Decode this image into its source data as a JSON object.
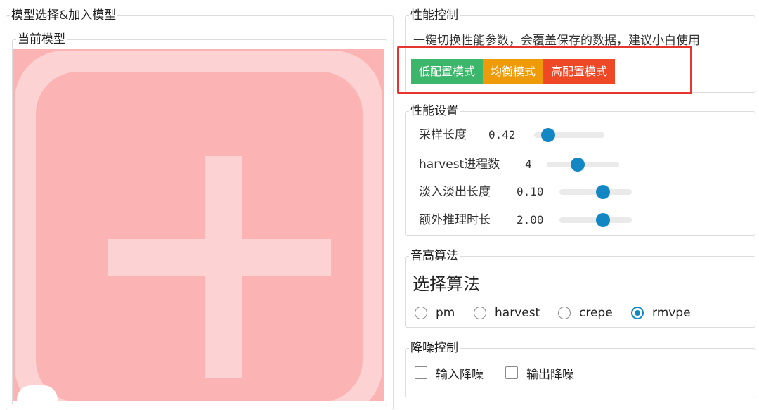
{
  "left": {
    "group_title": "模型选择&加入模型",
    "current_title": "当前模型",
    "add_tile_icon": "plus-icon"
  },
  "performance_control": {
    "title": "性能控制",
    "description": "一键切换性能参数，会覆盖保存的数据，建议小白使用",
    "buttons": [
      {
        "label": "低配置模式",
        "color": "#3cb66a"
      },
      {
        "label": "均衡模式",
        "color": "#ef9a08"
      },
      {
        "label": "高配置模式",
        "color": "#ef4827"
      }
    ],
    "highlight_color": "#e8342f"
  },
  "performance_settings": {
    "title": "性能设置",
    "rows": [
      {
        "label": "采样长度",
        "value": "0.42",
        "level": 0.2
      },
      {
        "label": "harvest进程数",
        "value": "4",
        "level": 0.43
      },
      {
        "label": "淡入淡出长度",
        "value": "0.10",
        "level": 0.6
      },
      {
        "label": "额外推理时长",
        "value": "2.00",
        "level": 0.6
      }
    ],
    "accent_color": "#1287c4"
  },
  "pitch": {
    "title": "音高算法",
    "subtitle": "选择算法",
    "options": [
      {
        "label": "pm",
        "checked": false
      },
      {
        "label": "harvest",
        "checked": false
      },
      {
        "label": "crepe",
        "checked": false
      },
      {
        "label": "rmvpe",
        "checked": true
      }
    ]
  },
  "noise": {
    "title": "降噪控制",
    "options": [
      {
        "label": "输入降噪",
        "checked": false
      },
      {
        "label": "输出降噪",
        "checked": false
      }
    ]
  }
}
